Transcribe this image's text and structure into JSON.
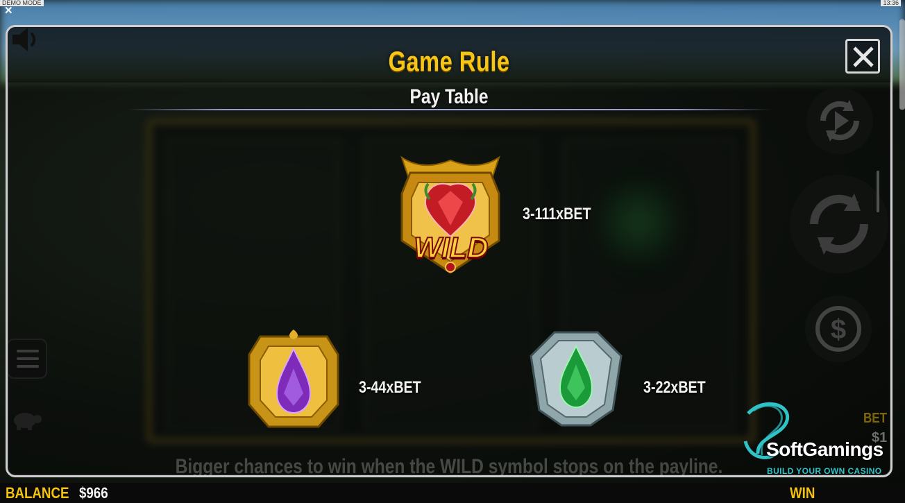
{
  "system": {
    "mode_label": "DEMO MODE",
    "clock": "13:36",
    "close_symbol": "✕"
  },
  "modal": {
    "title": "Game Rule",
    "subtitle": "Pay Table",
    "footer_text": "Bigger chances to win when the WILD symbol stops on the payline."
  },
  "paytable": [
    {
      "symbol": "wild-ruby",
      "symbol_text": "WILD",
      "payout": "3-111xBET"
    },
    {
      "symbol": "purple-gem",
      "payout": "3-44xBET"
    },
    {
      "symbol": "green-gem",
      "payout": "3-22xBET"
    }
  ],
  "bottom": {
    "balance_label": "BALANCE",
    "balance_value": "$966",
    "win_label": "WIN",
    "bet_label": "BET",
    "bet_value": "$1"
  },
  "watermark": {
    "name": "SoftGamings",
    "tagline": "BUILD YOUR OWN CASINO"
  },
  "colors": {
    "title_gold": "#f7c515",
    "label_gold": "#f4c20d",
    "watermark_teal": "#2fc3c8"
  },
  "icons": [
    "speaker-icon",
    "menu-icon",
    "turtle-icon",
    "autoplay-icon",
    "spin-icon",
    "bet-dollar-icon",
    "close-icon"
  ]
}
